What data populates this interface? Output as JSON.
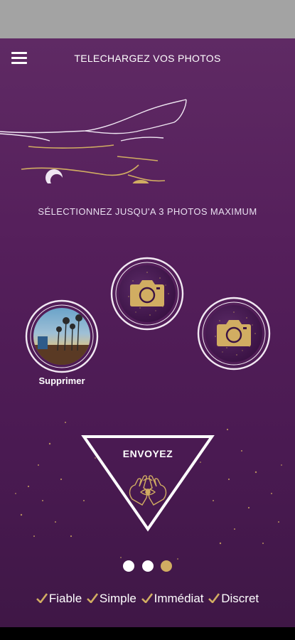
{
  "header": {
    "title": "TELECHARGEZ VOS PHOTOS"
  },
  "instruction": "SÉLECTIONNEZ JUSQU'A 3 PHOTOS MAXIMUM",
  "photos": {
    "delete_label": "Supprimer"
  },
  "send": {
    "label": "ENVOYEZ"
  },
  "pager": {
    "count": 3,
    "active_index": 2
  },
  "features": [
    "Fiable",
    "Simple",
    "Immédiat",
    "Discret"
  ],
  "colors": {
    "background_top": "#5f2a64",
    "background_bottom": "#3f1746",
    "gold": "#d1ad62",
    "white": "#ffffff"
  }
}
